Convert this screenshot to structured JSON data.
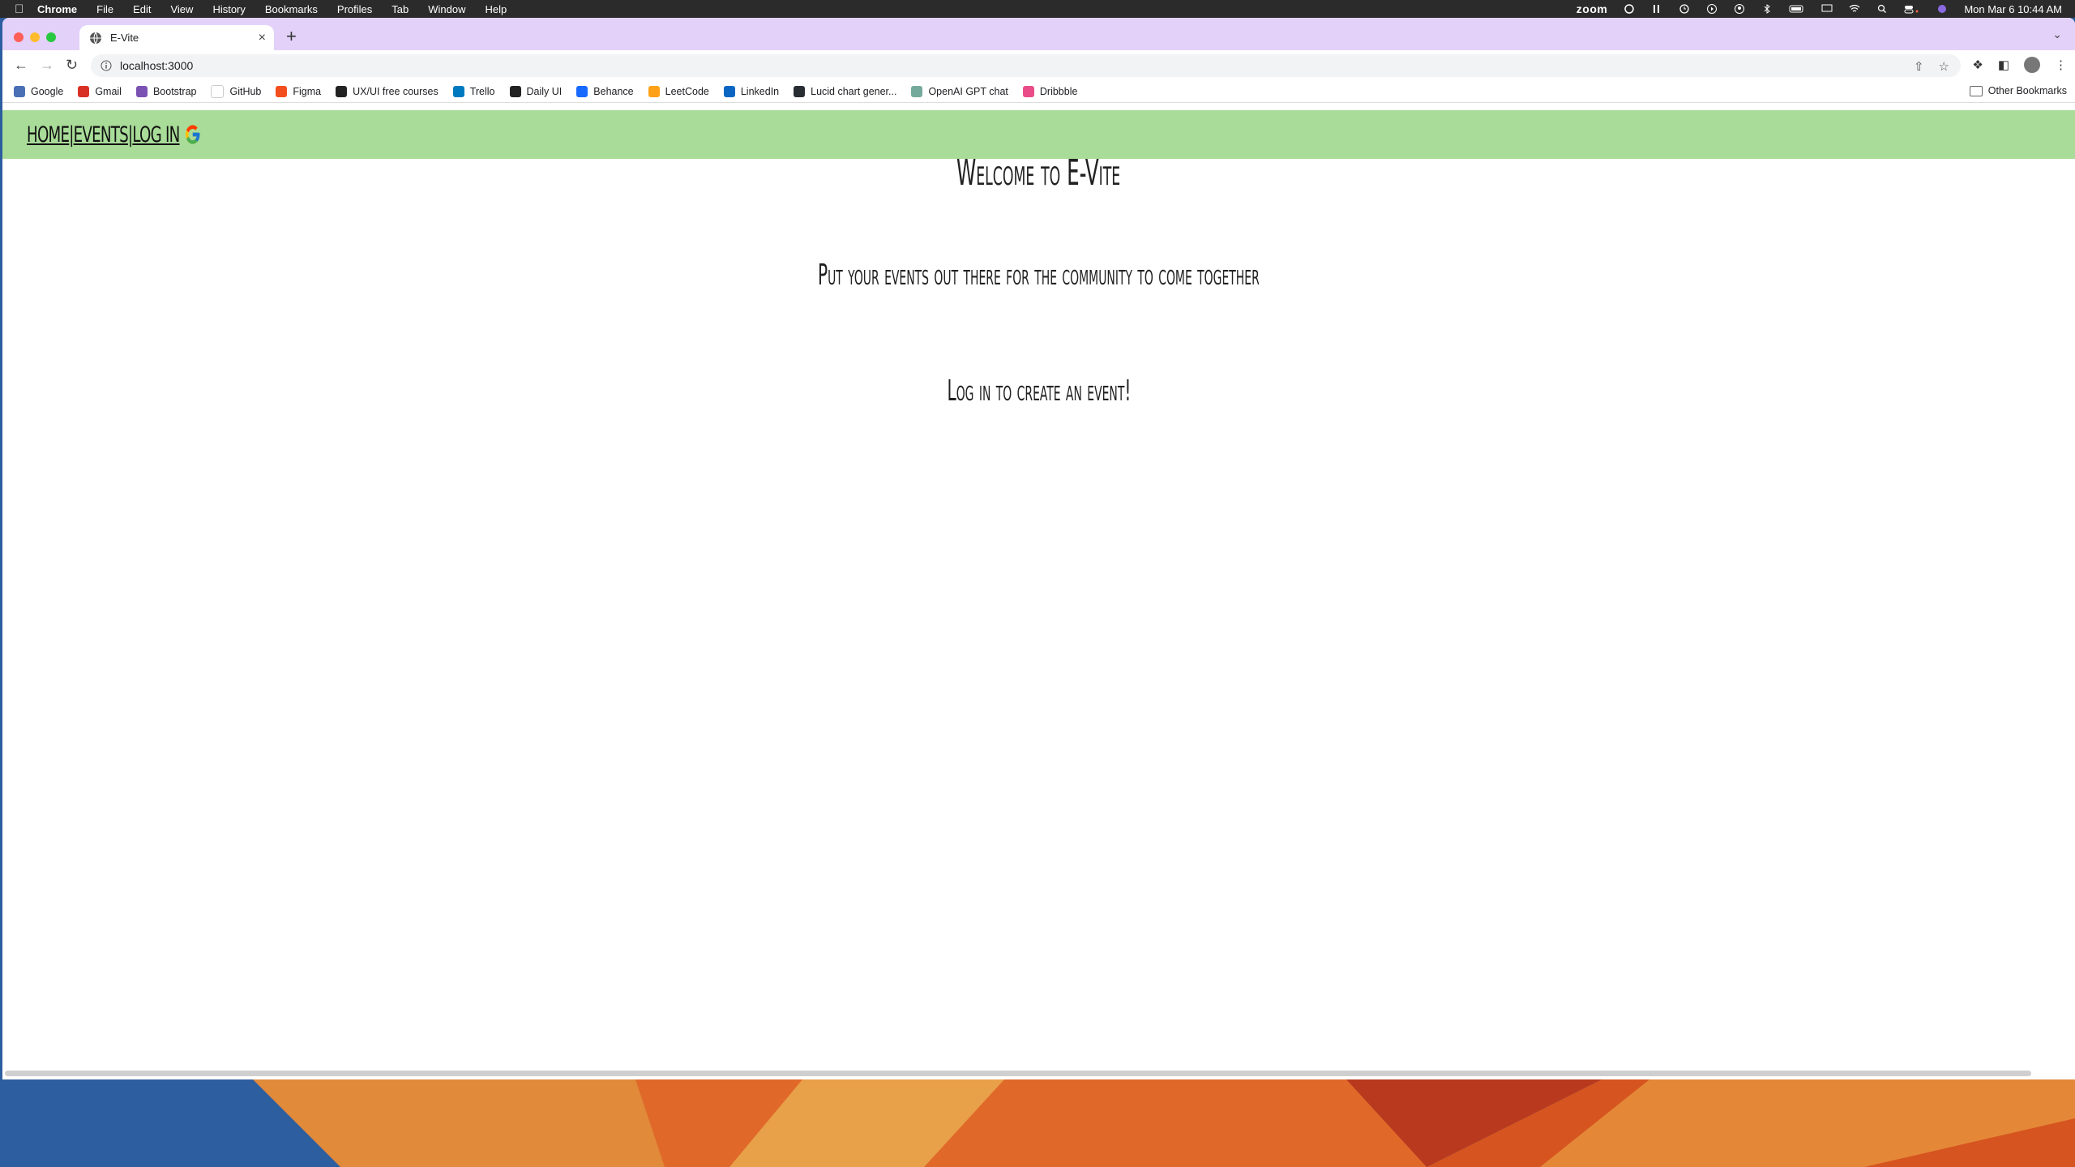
{
  "menubar": {
    "app": "Chrome",
    "items": [
      "File",
      "Edit",
      "View",
      "History",
      "Bookmarks",
      "Profiles",
      "Tab",
      "Window",
      "Help"
    ],
    "zoom_label": "zoom",
    "datetime": "Mon Mar 6  10:44 AM"
  },
  "browser": {
    "tab_title": "E-Vite",
    "url": "localhost:3000",
    "bookmarks": [
      {
        "label": "Google",
        "color": "#4a6fb5"
      },
      {
        "label": "Gmail",
        "color": "#d93025"
      },
      {
        "label": "Bootstrap",
        "color": "#7952b3"
      },
      {
        "label": "GitHub",
        "color": "#ffffff"
      },
      {
        "label": "Figma",
        "color": "#f24e1e"
      },
      {
        "label": "UX/UI free courses",
        "color": "#222222"
      },
      {
        "label": "Trello",
        "color": "#0079bf"
      },
      {
        "label": "Daily UI",
        "color": "#222222"
      },
      {
        "label": "Behance",
        "color": "#1769ff"
      },
      {
        "label": "LeetCode",
        "color": "#ffa116"
      },
      {
        "label": "LinkedIn",
        "color": "#0a66c2"
      },
      {
        "label": "Lucid chart gener...",
        "color": "#282c33"
      },
      {
        "label": "OpenAI GPT chat",
        "color": "#74aa9c"
      },
      {
        "label": "Dribbble",
        "color": "#ea4c89"
      }
    ],
    "other_bookmarks": "Other Bookmarks"
  },
  "site": {
    "nav_home": "HOME",
    "nav_events": "EVENTS",
    "nav_login": "LOG IN",
    "nav_sep": "|",
    "title": "Welcome to E-Vite",
    "subtitle": "Put your events out there for the community to come together",
    "cta": "Log in to create an event!"
  },
  "colors": {
    "nav_bg": "#a8dc98",
    "tabbar_bg": "#e3d1f9"
  }
}
